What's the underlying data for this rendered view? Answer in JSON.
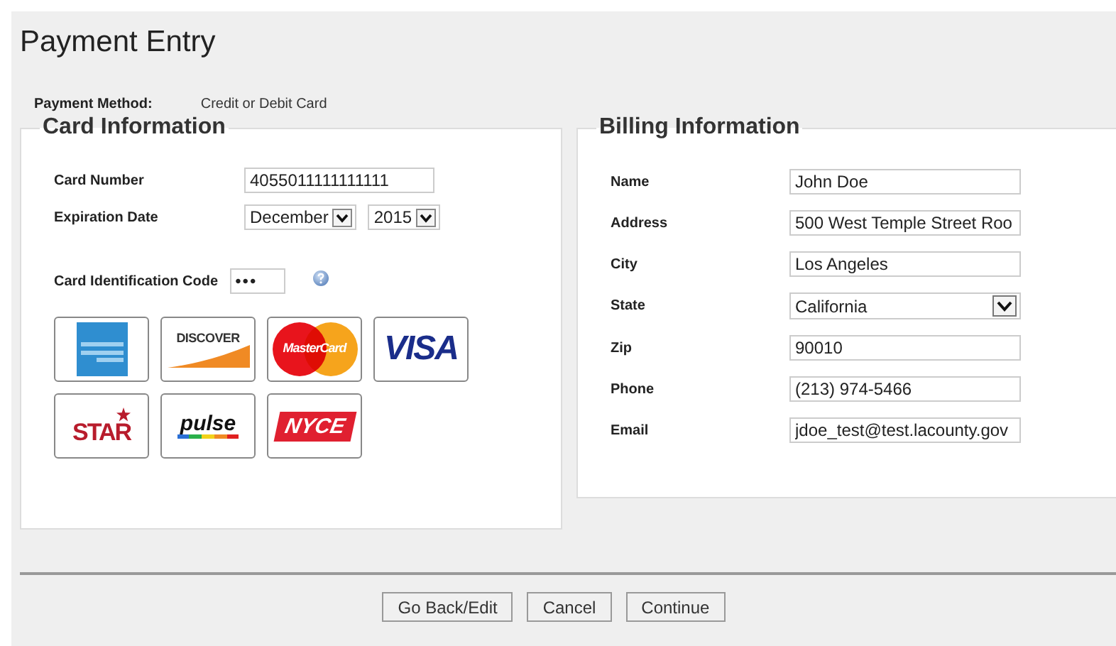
{
  "page": {
    "title": "Payment Entry"
  },
  "payment_method": {
    "label": "Payment Method:",
    "value": "Credit or Debit Card"
  },
  "card_information": {
    "heading": "Card Information",
    "card_number": {
      "label": "Card Number",
      "value": "4055011111111111"
    },
    "expiration": {
      "label": "Expiration Date",
      "month": "December",
      "year": "2015"
    },
    "cid": {
      "label": "Card Identification Code",
      "value": "•••"
    },
    "cards": [
      {
        "kind": "amex"
      },
      {
        "kind": "discover",
        "label": "DISCOVER"
      },
      {
        "kind": "mastercard",
        "label": "MasterCard"
      },
      {
        "kind": "visa",
        "label": "VISA"
      },
      {
        "kind": "star",
        "label": "STAR"
      },
      {
        "kind": "pulse",
        "label": "pulse"
      },
      {
        "kind": "nyce",
        "label": "NYCE"
      }
    ]
  },
  "billing_information": {
    "heading": "Billing Information",
    "fields": [
      {
        "kind": "text",
        "label": "Name",
        "value": "John Doe"
      },
      {
        "kind": "text",
        "label": "Address",
        "value": "500 West Temple Street Roo"
      },
      {
        "kind": "text",
        "label": "City",
        "value": "Los Angeles"
      },
      {
        "kind": "select",
        "label": "State",
        "value": "California"
      },
      {
        "kind": "text",
        "label": "Zip",
        "value": "90010"
      },
      {
        "kind": "text",
        "label": "Phone",
        "value": "(213) 974-5466"
      },
      {
        "kind": "text",
        "label": "Email",
        "value": "jdoe_test@test.lacounty.gov"
      }
    ]
  },
  "buttons": [
    "Go Back/Edit",
    "Cancel",
    "Continue"
  ]
}
